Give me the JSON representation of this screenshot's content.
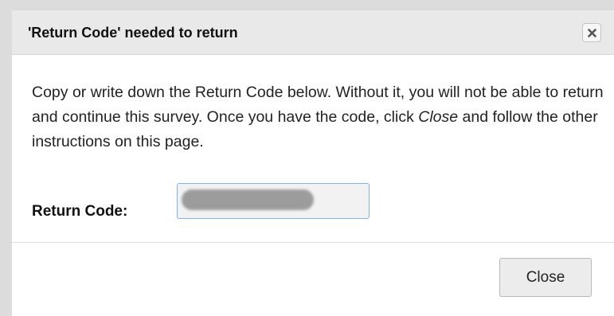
{
  "dialog": {
    "title": "'Return Code' needed to return",
    "close_icon": "close-x-icon",
    "message": {
      "part1": "Copy or write down the Return Code below. Without it, you will not be able to return and continue this survey. Once you have the code, click ",
      "emphasis": "Close",
      "part2": " and follow the other instructions on this page."
    },
    "code_label": "Return Code:",
    "code_value_redacted": true,
    "close_label": "Close"
  },
  "colors": {
    "title_bg": "#e9e9e9",
    "input_border": "#7fb5e6",
    "button_bg": "#ececec"
  }
}
